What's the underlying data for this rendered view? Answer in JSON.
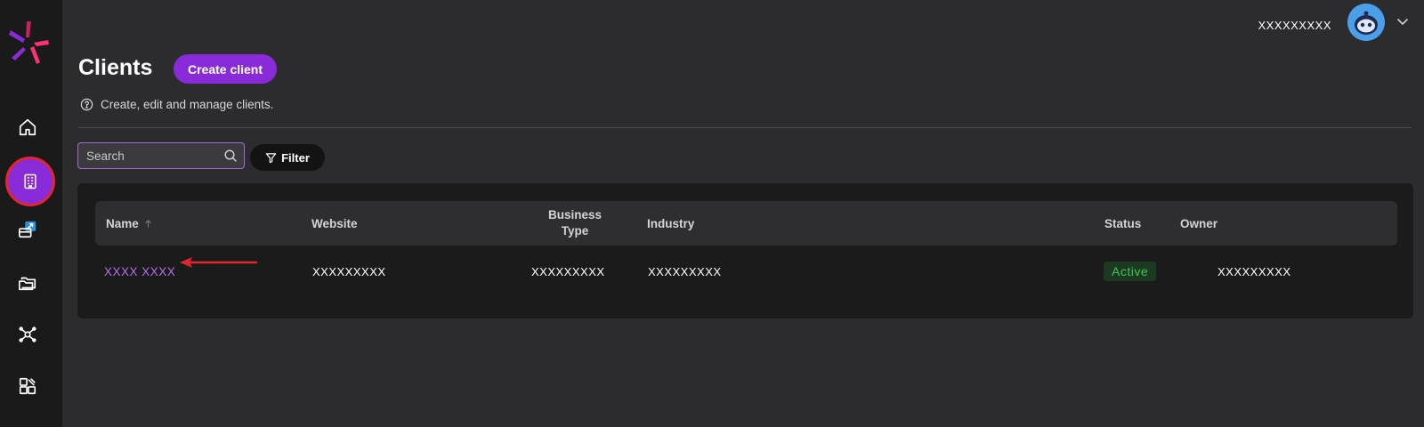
{
  "colors": {
    "accent": "#8a2bd9",
    "highlight_ring": "#e0272e",
    "status_active": "#46c35a",
    "annotation_arrow": "#e0272e"
  },
  "sidebar": {
    "items": [
      {
        "icon": "home-icon",
        "active": false
      },
      {
        "icon": "building-icon",
        "active": true
      },
      {
        "icon": "rocket-card-icon",
        "active": false
      },
      {
        "icon": "folders-icon",
        "active": false
      },
      {
        "icon": "network-icon",
        "active": false
      },
      {
        "icon": "layout-grid-icon",
        "active": false
      }
    ]
  },
  "header": {
    "user_name": "XXXXXXXXX"
  },
  "page": {
    "title": "Clients",
    "create_label": "Create client",
    "description": "Create, edit and manage clients."
  },
  "toolbar": {
    "search_placeholder": "Search",
    "filter_label": "Filter"
  },
  "table": {
    "columns": {
      "name": "Name",
      "website": "Website",
      "business_type_line1": "Business",
      "business_type_line2": "Type",
      "industry": "Industry",
      "status": "Status",
      "owner": "Owner"
    },
    "rows": [
      {
        "name": "XXXX XXXX",
        "website": "XXXXXXXXX",
        "business_type": "XXXXXXXXX",
        "industry": "XXXXXXXXX",
        "status": "Active",
        "owner": "XXXXXXXXX"
      }
    ]
  }
}
